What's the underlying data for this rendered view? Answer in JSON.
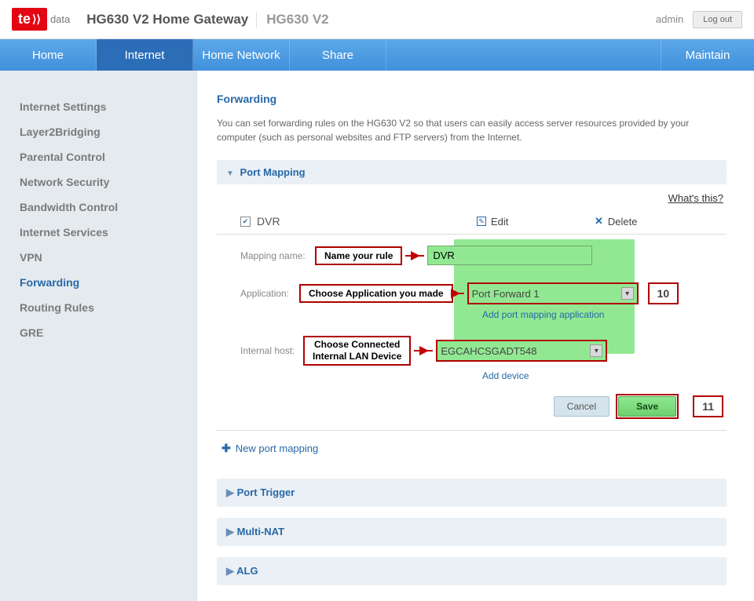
{
  "header": {
    "logo_main": "te",
    "logo_sub": "data",
    "device_title": "HG630 V2 Home Gateway",
    "device_model": "HG630 V2",
    "user": "admin",
    "logout": "Log out"
  },
  "nav": {
    "items": [
      "Home",
      "Internet",
      "Home Network",
      "Share"
    ],
    "active_index": 1,
    "maintain": "Maintain"
  },
  "sidebar": {
    "items": [
      "Internet Settings",
      "Layer2Bridging",
      "Parental Control",
      "Network Security",
      "Bandwidth Control",
      "Internet Services",
      "VPN",
      "Forwarding",
      "Routing Rules",
      "GRE"
    ],
    "active_index": 7
  },
  "content": {
    "title": "Forwarding",
    "description": "You can set forwarding rules on the HG630 V2 so that users can easily access server resources provided by your computer (such as personal websites and FTP servers) from the Internet.",
    "whats_this": "What's this?",
    "section_port_mapping": "Port Mapping",
    "rule": {
      "checked": true,
      "name": "DVR",
      "edit": "Edit",
      "delete": "Delete"
    },
    "form": {
      "mapping_name_label": "Mapping name:",
      "mapping_name_value": "DVR",
      "application_label": "Application:",
      "application_value": "Port Forward 1",
      "add_application_link": "Add port mapping application",
      "internal_host_label": "Internal host:",
      "internal_host_value": "EGCAHCSGADT548",
      "add_device_link": "Add device"
    },
    "instructions": {
      "name_rule": "Name your rule",
      "choose_app": "Choose Application you made",
      "choose_host_l1": "Choose Connected",
      "choose_host_l2": "Internal LAN Device",
      "step10": "10",
      "step11": "11"
    },
    "buttons": {
      "cancel": "Cancel",
      "save": "Save"
    },
    "new_mapping": "New port mapping",
    "sections_closed": [
      "Port Trigger",
      "Multi-NAT",
      "ALG"
    ]
  }
}
